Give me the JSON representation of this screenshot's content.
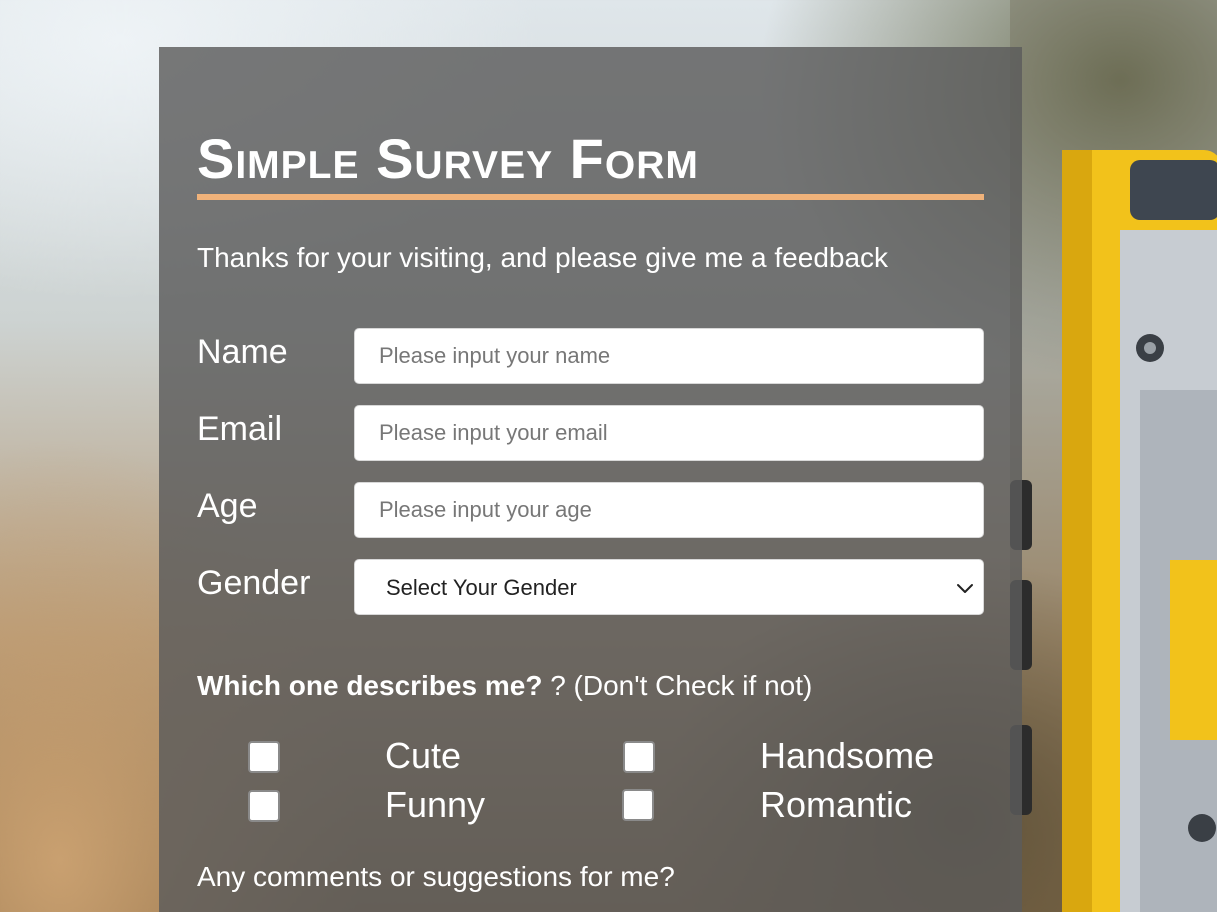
{
  "form": {
    "title": "Simple Survey Form",
    "subtitle": "Thanks for your visiting, and please give me a feedback",
    "accent_color": "#f0b27a",
    "fields": {
      "name": {
        "label": "Name",
        "placeholder": "Please input your name",
        "value": ""
      },
      "email": {
        "label": "Email",
        "placeholder": "Please input your email",
        "value": ""
      },
      "age": {
        "label": "Age",
        "placeholder": "Please input your age",
        "value": ""
      },
      "gender": {
        "label": "Gender",
        "selected": "Select Your Gender",
        "icon": "chevron-down-icon"
      }
    },
    "question": {
      "bold": "Which one describes me?",
      "rest": " ? (Don't Check if not)"
    },
    "options": [
      {
        "label": "Cute",
        "checked": false
      },
      {
        "label": "Handsome",
        "checked": false
      },
      {
        "label": "Funny",
        "checked": false
      },
      {
        "label": "Romantic",
        "checked": false
      }
    ],
    "comments_label": "Any comments or suggestions for me?"
  }
}
